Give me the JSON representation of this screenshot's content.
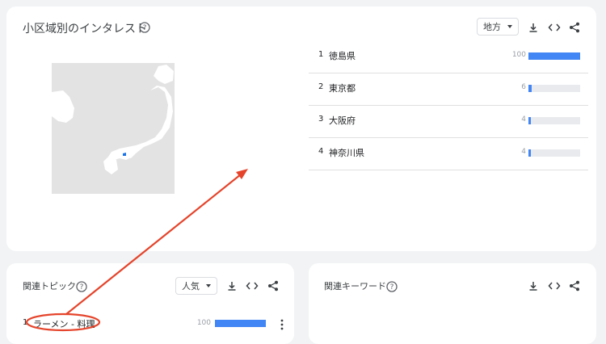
{
  "region_card": {
    "title": "小区域別のインタレスト",
    "region_select": "地方",
    "rows": [
      {
        "rank": "1",
        "name": "徳島県",
        "value": "100",
        "fraction": 1.0
      },
      {
        "rank": "2",
        "name": "東京都",
        "value": "6",
        "fraction": 0.06
      },
      {
        "rank": "3",
        "name": "大阪府",
        "value": "4",
        "fraction": 0.04
      },
      {
        "rank": "4",
        "name": "神奈川県",
        "value": "4",
        "fraction": 0.04
      }
    ]
  },
  "topics_card": {
    "title": "関連トピック",
    "sort_select": "人気",
    "item": {
      "rank": "1",
      "label": "ラーメン - 料理",
      "value": "100",
      "fraction": 1.0
    }
  },
  "keywords_card": {
    "title": "関連キーワード"
  },
  "colors": {
    "bar": "#4285f4",
    "annotation": "#e5442b",
    "map_land": "#dadce0",
    "highlight": "#1a73e8"
  }
}
